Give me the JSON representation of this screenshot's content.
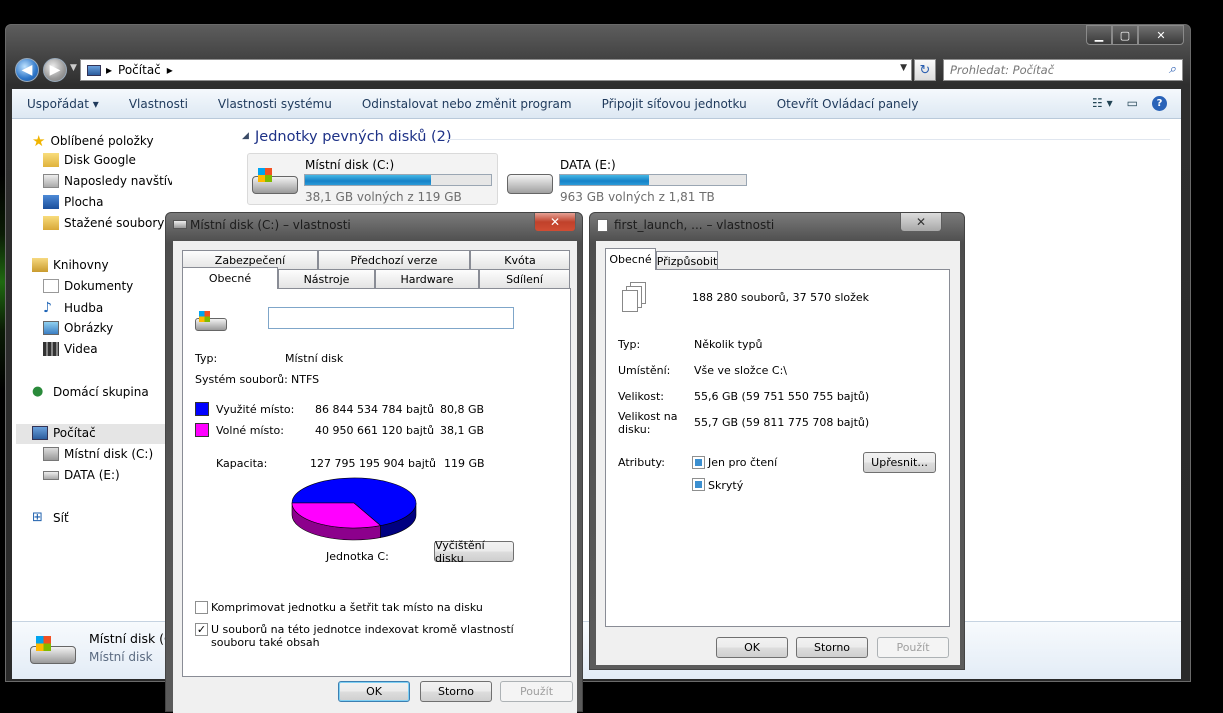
{
  "explorer": {
    "address_path": "Počítač",
    "search_placeholder": "Prohledat: Počítač",
    "commands": [
      "Uspořádat",
      "Vlastnosti",
      "Vlastnosti systému",
      "Odinstalovat nebo změnit program",
      "Připojit síťovou jednotku",
      "Otevřít Ovládací panely"
    ],
    "nav": {
      "favorites": "Oblíbené položky",
      "fav_items": [
        "Disk Google",
        "Naposledy navštívené",
        "Plocha",
        "Stažené soubory"
      ],
      "libraries": "Knihovny",
      "lib_items": [
        "Dokumenty",
        "Hudba",
        "Obrázky",
        "Videa"
      ],
      "homegroup": "Domácí skupina",
      "computer": "Počítač",
      "computer_items": [
        "Místní disk (C:)",
        "DATA (E:)"
      ],
      "network": "Síť"
    },
    "group_title": "Jednotky pevných disků (2)",
    "drives": [
      {
        "name": "Místní disk (C:)",
        "free_text": "38,1 GB volných z 119 GB",
        "used_fraction": 0.68
      },
      {
        "name": "DATA (E:)",
        "free_text": "963 GB volných z 1,81 TB",
        "used_fraction": 0.48
      }
    ],
    "details": {
      "name": "Místní disk (C",
      "type": "Místní disk"
    }
  },
  "disk_dialog": {
    "title": "Místní disk (C:) – vlastnosti",
    "tabs_back": [
      "Zabezpečení",
      "Předchozí verze",
      "Kvóta"
    ],
    "tabs_front": [
      "Obecné",
      "Nástroje",
      "Hardware",
      "Sdílení"
    ],
    "name_value": "",
    "type_label": "Typ:",
    "type_value": "Místní disk",
    "fs_label": "Systém souborů:",
    "fs_value": "NTFS",
    "used_label": "Využité místo:",
    "used_bytes": "86 844 534 784 bajtů",
    "used_size": "80,8 GB",
    "free_label": "Volné místo:",
    "free_bytes": "40 950 661 120 bajtů",
    "free_size": "38,1 GB",
    "cap_label": "Kapacita:",
    "cap_bytes": "127 795 195 904 bajtů",
    "cap_size": "119 GB",
    "drive_caption": "Jednotka C:",
    "cleanup_button": "Vyčištění disku",
    "compress_label": "Komprimovat jednotku a šetřit tak místo na disku",
    "index_label_1": "U souborů na této jednotce indexovat kromě vlastností",
    "index_label_2": "souboru také obsah",
    "ok": "OK",
    "cancel": "Storno",
    "apply": "Použít",
    "colors": {
      "used": "#0000ff",
      "free": "#ff00ff"
    }
  },
  "folder_dialog": {
    "title": "first_launch, ... – vlastnosti",
    "tabs": [
      "Obecné",
      "Přizpůsobit"
    ],
    "summary": "188 280 souborů, 37 570 složek",
    "type_label": "Typ:",
    "type_value": "Několik typů",
    "location_label": "Umístění:",
    "location_value": "Vše ve složce C:\\",
    "size_label": "Velikost:",
    "size_value": "55,6 GB (59 751 550 755 bajtů)",
    "disksize_label_1": "Velikost na",
    "disksize_label_2": "disku:",
    "disksize_value": "55,7 GB (59 811 775 708 bajtů)",
    "attr_label": "Atributy:",
    "readonly_label": "Jen pro čtení",
    "hidden_label": "Skrytý",
    "advanced_button": "Upřesnit...",
    "ok": "OK",
    "cancel": "Storno",
    "apply": "Použít"
  }
}
